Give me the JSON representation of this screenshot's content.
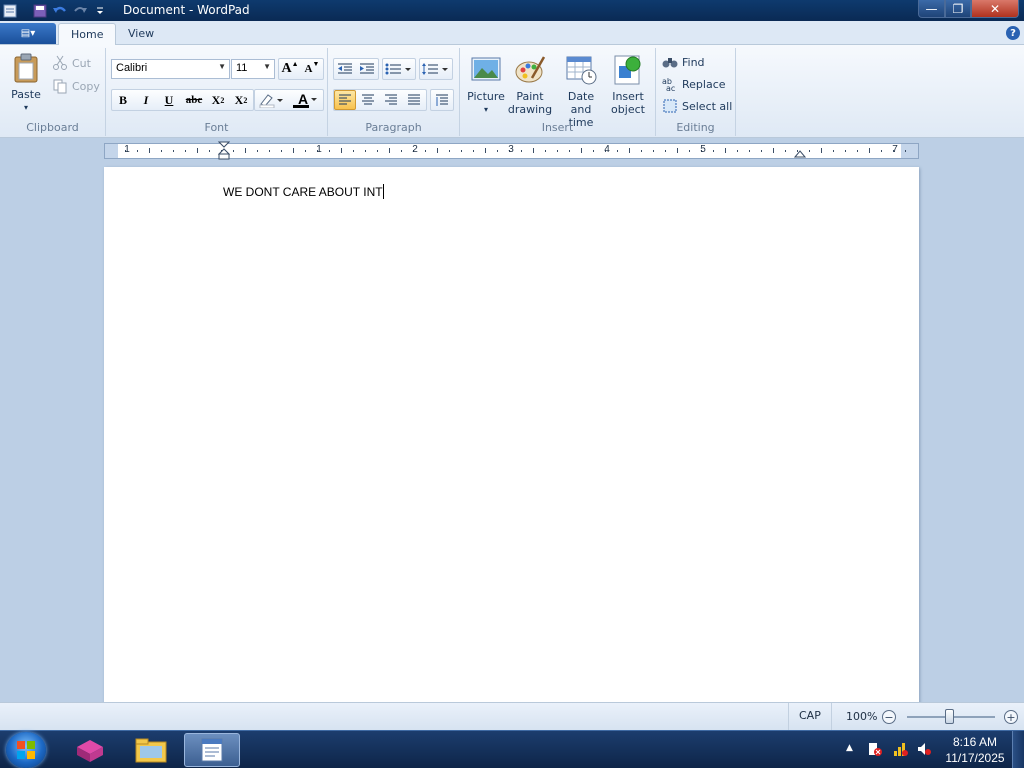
{
  "window": {
    "title": "Document - WordPad",
    "minimize": "—",
    "maximize": "❐",
    "close": "✕"
  },
  "ribbon": {
    "app_button_glyph": "▤▾",
    "tabs": [
      {
        "label": "Home"
      },
      {
        "label": "View"
      }
    ],
    "help": "?",
    "clipboard": {
      "label": "Clipboard",
      "paste": "Paste",
      "paste_arrow": "▾",
      "cut": "Cut",
      "copy": "Copy"
    },
    "font": {
      "label": "Font",
      "family": "Calibri",
      "size": "11",
      "grow": "A",
      "shrink": "A",
      "bold": "B",
      "italic": "I",
      "underline": "U",
      "strike": "abc",
      "subscript": "X",
      "subscript_mark": "2",
      "superscript": "X",
      "superscript_mark": "2",
      "text_color_letter": "A"
    },
    "paragraph": {
      "label": "Paragraph"
    },
    "insert": {
      "label": "Insert",
      "picture": "Picture",
      "picture_arrow": "▾",
      "paint_drawing_line1": "Paint",
      "paint_drawing_line2": "drawing",
      "date_time_line1": "Date and",
      "date_time_line2": "time",
      "insert_object_line1": "Insert",
      "insert_object_line2": "object"
    },
    "editing": {
      "label": "Editing",
      "find": "Find",
      "replace": "Replace",
      "select_all": "Select all"
    }
  },
  "ruler": {
    "numbers": [
      "1",
      "1",
      "2",
      "3",
      "4",
      "5",
      "7"
    ]
  },
  "document": {
    "text": "WE DONT CARE ABOUT INT"
  },
  "statusbar": {
    "caps": "CAP",
    "zoom": "100%",
    "zoom_level_percent": 100,
    "zoom_out": "−",
    "zoom_in": "+"
  },
  "taskbar": {
    "tray_arrow": "▲",
    "time": "8:16 AM",
    "date": "11/17/2025"
  },
  "colors": {
    "ribbon_bg": "#dfe9f5",
    "titlebar": "#0e3a6e",
    "active_align": "#f8c24f",
    "taskbar": "#1c3d6e"
  }
}
